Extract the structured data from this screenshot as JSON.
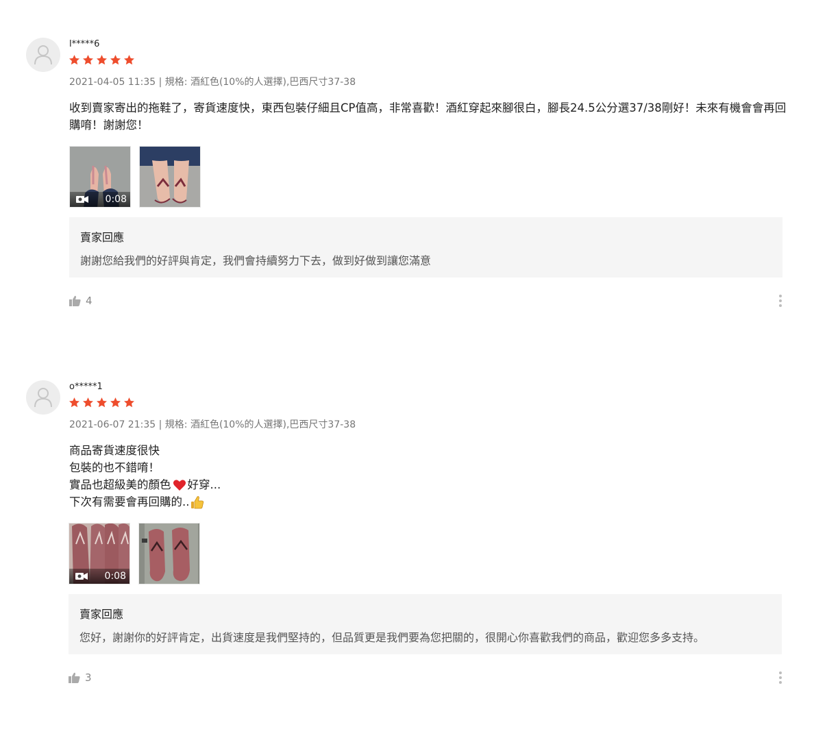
{
  "colors": {
    "star": "#ee4d2d",
    "meta": "#757575",
    "reply_bg": "#f5f5f5"
  },
  "reviews": [
    {
      "author": "l*****6",
      "rating": 5,
      "meta": "2021-04-05 11:35 | 規格: 酒紅色(10%的人選擇),巴西尺寸37-38",
      "content": "收到賣家寄出的拖鞋了，寄貨速度快，東西包裝仔細且CP值高，非常喜歡！酒紅穿起來腳很白，腳長24.5公分選37/38剛好！未來有機會會再回購唷！謝謝您！",
      "video_duration": "0:08",
      "reply_title": "賣家回應",
      "reply_text": "謝謝您給我們的好評與肯定，我們會持續努力下去，做到好做到讓您滿意",
      "likes": "4"
    },
    {
      "author": "o*****1",
      "rating": 5,
      "meta": "2021-06-07 21:35 | 規格: 酒紅色(10%的人選擇),巴西尺寸37-38",
      "content_lines": [
        "商品寄貨速度很快",
        "包裝的也不錯唷！",
        "實品也超級美的顏色",
        "好穿...",
        "下次有需要會再回購的.."
      ],
      "video_duration": "0:08",
      "reply_title": "賣家回應",
      "reply_text": "您好，謝謝你的好評肯定，出貨速度是我們堅持的，但品質更是我們要為您把關的，很開心你喜歡我們的商品，歡迎您多多支持。",
      "likes": "3"
    }
  ]
}
